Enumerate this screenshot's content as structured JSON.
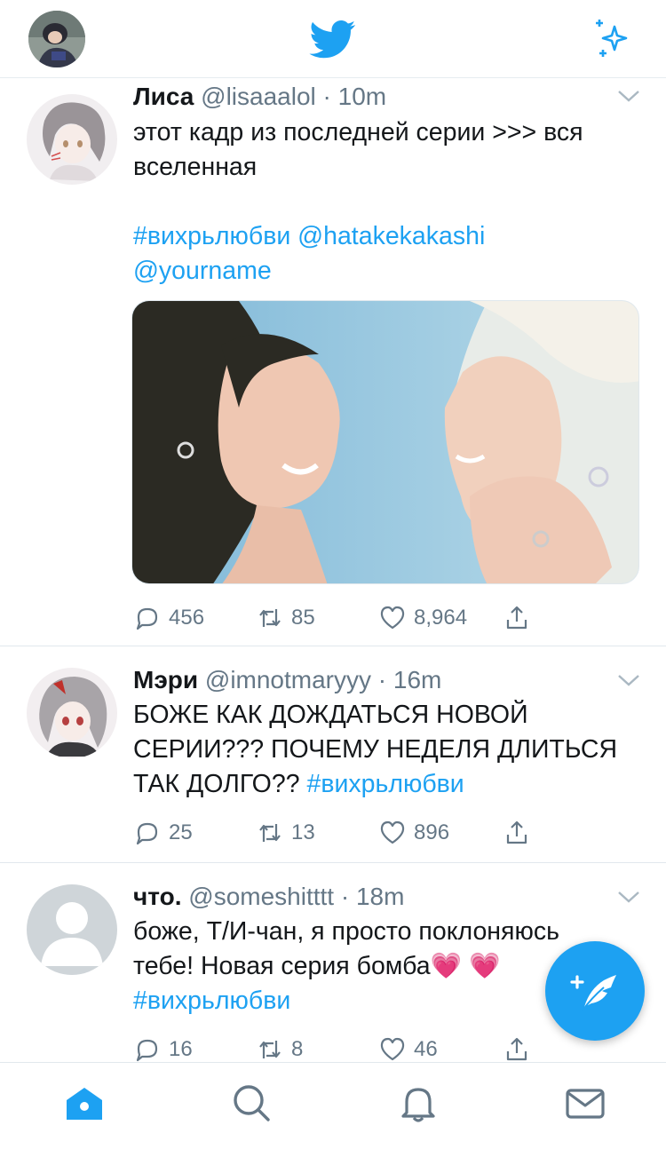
{
  "header": {
    "avatar_icon": "profile-avatar",
    "logo_icon": "twitter-bird-icon",
    "sparkle_icon": "sparkle-icon"
  },
  "tweets": [
    {
      "name": "Лиса",
      "handle": "@lisaaalol",
      "time": "10m",
      "text_line1": "этот кадр из последней серии >>> вся",
      "text_line2": "вселенная",
      "hashtag": "#вихрьлюбви",
      "mention1": "@hatakekakashi",
      "mention2": "@yourname",
      "replies": "456",
      "retweets": "85",
      "likes": "8,964"
    },
    {
      "name": "Мэри",
      "handle": "@imnotmaryyy",
      "time": "16m",
      "text_line1": "БОЖЕ КАК ДОЖДАТЬСЯ НОВОЙ",
      "text_line2": "СЕРИИ??? ПОЧЕМУ НЕДЕЛЯ ДЛИТЬСЯ",
      "text_line3": "ТАК ДОЛГО??",
      "hashtag": "#вихрьлюбви",
      "replies": "25",
      "retweets": "13",
      "likes": "896"
    },
    {
      "name": "что.",
      "handle": "@someshitttt",
      "time": "18m",
      "text_line1": "боже, Т/И-чан, я просто поклоняюсь",
      "text_line2": "тебе! Новая серия бомба",
      "emoji": "💗 💗",
      "hashtag": "#вихрьлюбви",
      "replies": "16",
      "retweets": "8",
      "likes": "46"
    }
  ],
  "colors": {
    "accent": "#1da1f2",
    "text": "#14171a",
    "muted": "#657786",
    "divider": "#e1e8ed"
  },
  "tabbar": [
    "home-icon",
    "search-icon",
    "notifications-icon",
    "messages-icon"
  ]
}
